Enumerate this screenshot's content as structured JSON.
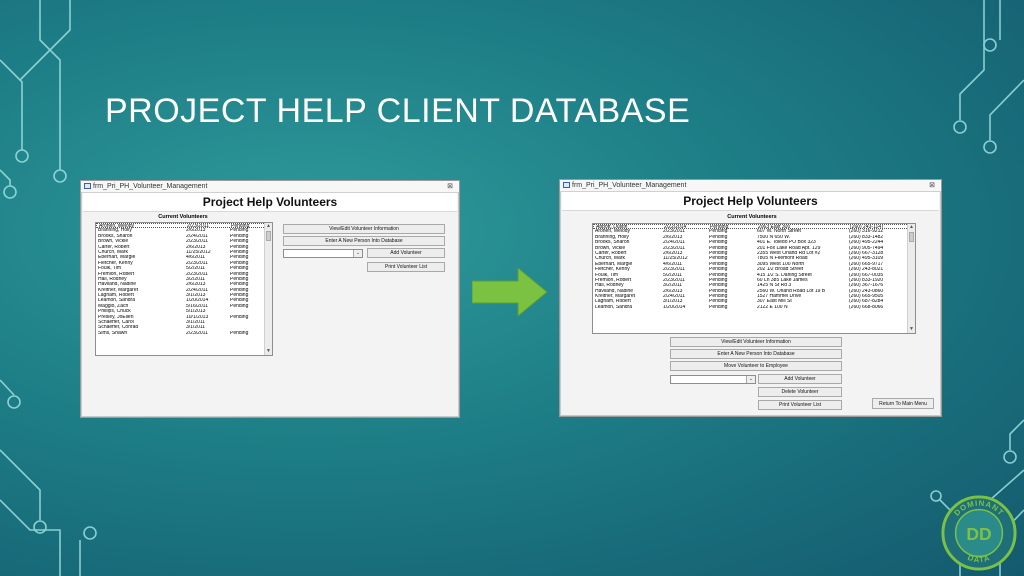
{
  "slide": {
    "title": "PROJECT HELP CLIENT DATABASE"
  },
  "logo": {
    "top_text": "DOMINANT",
    "bottom_text": "DATA",
    "monogram": "DD"
  },
  "colors": {
    "arrow": "#7cc242",
    "logo_ring": "#7cc242",
    "background": "#1d7d86"
  },
  "left_window": {
    "title": "frm_Pri_PH_Volunteer_Management",
    "header": "Project Help Volunteers",
    "list_label": "Current Volunteers",
    "rows": [
      [
        "Aronen, Melody",
        "2/23/2011",
        "Pending"
      ],
      [
        "Branning, Holly",
        "2/6/2013",
        "Pending"
      ],
      [
        "Brooks, Sharon",
        "2/24/2011",
        "Pending"
      ],
      [
        "Brown, Vickie",
        "2/23/2011",
        "Pending"
      ],
      [
        "Carter, Robert",
        "2/6/2013",
        "Pending"
      ],
      [
        "Church, Mark",
        "11/25/2012",
        "Pending"
      ],
      [
        "Eberhart, Margie",
        "4/6/2011",
        "Pending"
      ],
      [
        "Fletcher, Kenny",
        "2/23/2011",
        "Pending"
      ],
      [
        "Foulk, Tim",
        "5/2/2011",
        "Pending"
      ],
      [
        "Fremion, Robert",
        "2/23/2011",
        "Pending"
      ],
      [
        "Hall, Rodney",
        "3/2/2011",
        "Pending"
      ],
      [
        "Haviland, Nadine",
        "2/6/2013",
        "Pending"
      ],
      [
        "Kreitner, Margaret",
        "2/24/2011",
        "Pending"
      ],
      [
        "Lagham, Robert",
        "3/1/2013",
        "Pending"
      ],
      [
        "Leamon, Sandra",
        "1/20/2014",
        "Pending"
      ],
      [
        "Maggio, Zach",
        "5/16/2011",
        "Pending"
      ],
      [
        "Phillips, Chuck",
        "5/1/2013",
        ""
      ],
      [
        "Presley, JoEllen",
        "10/1/2013",
        "Pending"
      ],
      [
        "Schaeffer, Carol",
        "3/1/2011",
        ""
      ],
      [
        "Schaeffer, Conrad",
        "3/1/2011",
        ""
      ],
      [
        "Sims, Shawn",
        "2/23/2011",
        "Pending"
      ]
    ],
    "buttons": {
      "view_edit": "View/Edit Volunteer Information",
      "enter_new": "Enter A New Person Into Database",
      "add": "Add Volunteer",
      "print": "Print Volunteer List"
    }
  },
  "right_window": {
    "title": "frm_Pri_PH_Volunteer_Management",
    "header": "Project Help Volunteers",
    "list_label": "Current Volunteers",
    "rows": [
      [
        "Abbott, Dustin",
        "2/22/2014",
        "Pending",
        "2063 East 300",
        "(260) 243-1147"
      ],
      [
        "Aronen, Melody",
        "2/23/2011",
        "Pending",
        "607 W. North Street",
        "(260) 316-9212"
      ],
      [
        "Branning, Holly",
        "2/6/2013",
        "Pending",
        "7500 N 650 W.",
        "(260) 833-1482"
      ],
      [
        "Brooks, Sharon",
        "2/24/2011",
        "Pending",
        "401 E. Toledo  PO Box 323",
        "(260) 495-2244"
      ],
      [
        "Brown, Vickie",
        "2/23/2011",
        "Pending",
        "201 Fox Lake Road  Apt. 129",
        "(260) 905-7494"
      ],
      [
        "Carter, Robert",
        "2/6/2013",
        "Pending",
        "2355 West Orland Rd  Lot #2",
        "(260) 667-3128"
      ],
      [
        "Church, Mark",
        "11/25/2012",
        "Pending",
        "7805 N Feemont Road",
        "(260) 495-3109"
      ],
      [
        "Eberhart, Margie",
        "4/6/2011",
        "Pending",
        "3095 West 100 North",
        "(260) 665-9717"
      ],
      [
        "Fletcher, Kenny",
        "2/23/2011",
        "Pending",
        "202  1/2 Broad Street",
        "(260) 243-8021"
      ],
      [
        "Foulk, Tim",
        "5/2/2011",
        "Pending",
        "415 1/2 S. Darling Street",
        "(260) 667-0035"
      ],
      [
        "Fremion, Robert",
        "2/23/2011",
        "Pending",
        "60 Ln 385 Lake James",
        "(260) 833-1920"
      ],
      [
        "Hall, Rodney",
        "3/2/2011",
        "Pending",
        "1425 N St Rd 3",
        "(260) 367-1676"
      ],
      [
        "Haviland, Nadine",
        "2/6/2013",
        "Pending",
        "2560 W. Orland Road  Lot 19 B",
        "(260) 243-0860"
      ],
      [
        "Kreitner, Margaret",
        "2/24/2011",
        "Pending",
        "1527  Hammel Drive",
        "(260) 665-9505"
      ],
      [
        "Lagham, Robert",
        "3/1/2013",
        "Pending",
        "307 East Mill St",
        "(260) 687-8284"
      ],
      [
        "Leamon, Sandra",
        "1/20/2014",
        "Pending",
        "2122  E   100 N",
        "(260) 668-8066"
      ]
    ],
    "buttons": {
      "view_edit": "View/Edit Volunteer Information",
      "enter_new": "Enter A New Person Into Database",
      "move": "Move Volunteer to Employee",
      "add": "Add Volunteer",
      "delete": "Delete Volunteer",
      "print": "Print Volunteer List",
      "return": "Return To Main Menu"
    }
  }
}
